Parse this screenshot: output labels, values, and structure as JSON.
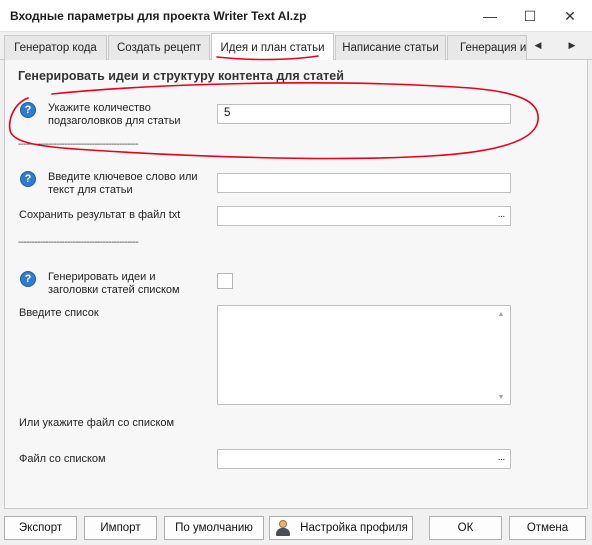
{
  "window": {
    "title": "Входные параметры для проекта Writer Text AI.zp",
    "minimize_glyph": "—",
    "maximize_glyph": "☐",
    "close_glyph": "✕"
  },
  "tabs": [
    {
      "label": "Генератор кода",
      "active": false
    },
    {
      "label": "Создать рецепт",
      "active": false
    },
    {
      "label": "Идея и план статьи",
      "active": true
    },
    {
      "label": "Написание статьи",
      "active": false
    },
    {
      "label": "Генерация и",
      "active": false
    }
  ],
  "tab_scroll": {
    "left": "◀",
    "right": "▶"
  },
  "section": {
    "title": "Генерировать идеи и структуру контента для статей",
    "divider": "--------------------------------------------"
  },
  "fields": {
    "subheadings": {
      "label": "Укажите количество подзаголовков для статьи",
      "value": "5"
    },
    "keyword": {
      "label": "Введите ключевое слово или текст для статьи",
      "value": ""
    },
    "save_file": {
      "label": "Сохранить результат в файл txt",
      "value": "",
      "browse": "···"
    },
    "generate_list": {
      "label": "Генерировать идеи и заголовки статей списком",
      "checked": false
    },
    "list": {
      "label": "Введите список",
      "value": ""
    },
    "list_file_hint": {
      "label": "Или укажите файл со списком"
    },
    "list_file": {
      "label": "Файл со списком",
      "value": "",
      "browse": "···"
    }
  },
  "help_icon": "?",
  "footer": {
    "export": "Экспорт",
    "import": "Импорт",
    "default": "По умолчанию",
    "profile": "Настройка профиля",
    "ok": "ОК",
    "cancel": "Отмена"
  },
  "colors": {
    "annotation": "#e8001c",
    "help_icon": "#2f7bd0"
  },
  "icons": {
    "help": "question-circle-icon",
    "profile": "user-profile-icon",
    "browse": "ellipsis-icon"
  }
}
